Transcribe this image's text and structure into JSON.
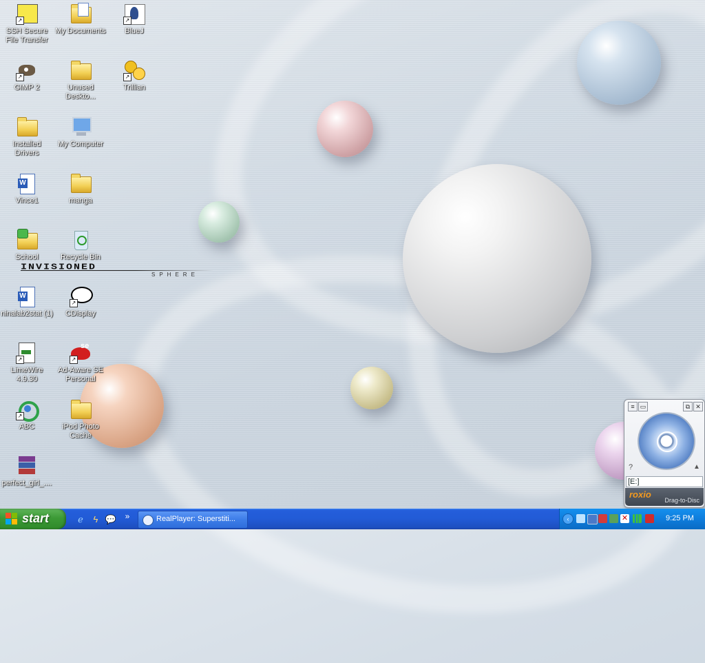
{
  "desktop": {
    "icons": [
      {
        "label": "SSH Secure File Transfer",
        "kind": "folder-yellow",
        "shortcut": true
      },
      {
        "label": "My Documents",
        "kind": "mydocs",
        "shortcut": false
      },
      {
        "label": "BlueJ",
        "kind": "bluej",
        "shortcut": true
      },
      {
        "label": "GIMP 2",
        "kind": "gimp",
        "shortcut": true
      },
      {
        "label": "Unused Deskto...",
        "kind": "folder",
        "shortcut": false
      },
      {
        "label": "Trillian",
        "kind": "trillian",
        "shortcut": true
      },
      {
        "label": "Installed Drivers",
        "kind": "folder",
        "shortcut": false
      },
      {
        "label": "My Computer",
        "kind": "computer",
        "shortcut": false
      },
      {
        "label": "Vince1",
        "kind": "word",
        "shortcut": false
      },
      {
        "label": "manga",
        "kind": "folder",
        "shortcut": false
      },
      {
        "label": "School",
        "kind": "folder-green",
        "shortcut": false
      },
      {
        "label": "Recycle Bin",
        "kind": "recycle",
        "shortcut": false
      },
      {
        "label": "ninalab2stat (1)",
        "kind": "word",
        "shortcut": false
      },
      {
        "label": "CDisplay",
        "kind": "cdisplay",
        "shortcut": true
      },
      {
        "label": "LimeWire 4.9.30",
        "kind": "limewire",
        "shortcut": true
      },
      {
        "label": "Ad-Aware SE Personal",
        "kind": "adaware",
        "shortcut": true
      },
      {
        "label": "ABC",
        "kind": "abc",
        "shortcut": true
      },
      {
        "label": "iPod Photo Cache",
        "kind": "folder",
        "shortcut": false
      },
      {
        "label": "perfect_girl_....",
        "kind": "winrar",
        "shortcut": false
      }
    ],
    "wallpaper_logo": {
      "main": "INVISIONED",
      "sub": "SPHERE"
    }
  },
  "taskbar": {
    "start_label": "start",
    "quicklaunch": [
      "ie-icon",
      "winamp-icon",
      "chat-icon"
    ],
    "overflow": "»",
    "task_button_label": "RealPlayer: Superstiti...",
    "tray_chevron": "‹",
    "clock": "9:25 PM"
  },
  "roxio": {
    "drive": "[E:]",
    "brand": "roxio",
    "tagline": "Drag-to-Disc",
    "help": "?",
    "eject": "▲"
  },
  "colors": {
    "taskbar": "#245edb",
    "start": "#3c9a36",
    "tray": "#0f7ddc"
  }
}
